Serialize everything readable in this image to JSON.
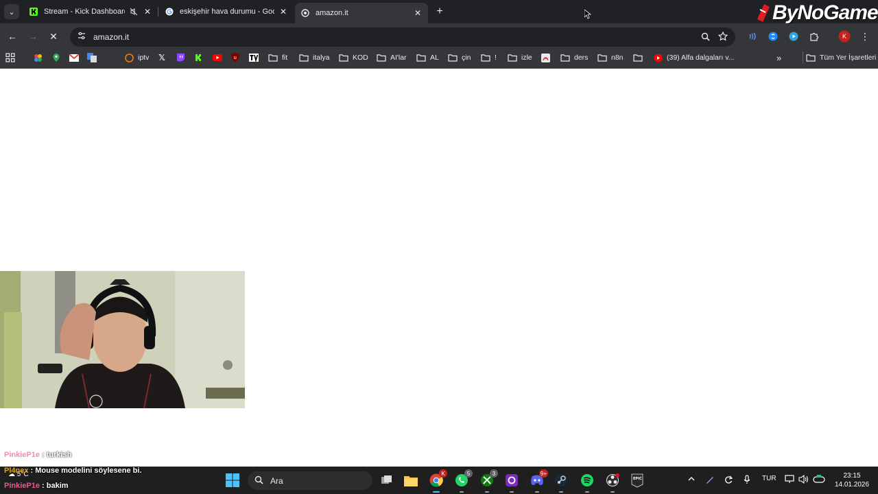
{
  "browser": {
    "tabs": [
      {
        "title": "Stream - Kick Dashboard",
        "muted": true
      },
      {
        "title": "eskişehir hava durumu - Google"
      },
      {
        "title": "amazon.it",
        "active": true
      }
    ],
    "address": "amazon.it",
    "bookmarks": [
      {
        "label": "",
        "icon": "google-photos-icon"
      },
      {
        "label": "",
        "icon": "google-maps-icon"
      },
      {
        "label": "",
        "icon": "gmail-icon"
      },
      {
        "label": "",
        "icon": "google-translate-icon"
      },
      {
        "label": "iptv",
        "icon": "iptv-icon"
      },
      {
        "label": "",
        "icon": "x-icon"
      },
      {
        "label": "",
        "icon": "twitch-icon"
      },
      {
        "label": "",
        "icon": "kick-icon"
      },
      {
        "label": "",
        "icon": "youtube-icon"
      },
      {
        "label": "",
        "icon": "ublock-icon"
      },
      {
        "label": "",
        "icon": "tradingview-icon"
      },
      {
        "label": "fit",
        "icon": "folder-icon"
      },
      {
        "label": "italya",
        "icon": "folder-icon"
      },
      {
        "label": "KOD",
        "icon": "folder-icon"
      },
      {
        "label": "AI'lar",
        "icon": "folder-icon"
      },
      {
        "label": "AL",
        "icon": "folder-icon"
      },
      {
        "label": "çin",
        "icon": "folder-icon"
      },
      {
        "label": "!",
        "icon": "folder-icon"
      },
      {
        "label": "izle",
        "icon": "folder-icon"
      },
      {
        "label": "",
        "icon": "pdf-icon"
      },
      {
        "label": "ders",
        "icon": "folder-icon"
      },
      {
        "label": "n8n",
        "icon": "folder-icon"
      },
      {
        "label": "",
        "icon": "folder-icon"
      },
      {
        "label": "(39) Alfa dalgaları v...",
        "icon": "youtube-icon"
      }
    ],
    "all_bookmarks": "Tüm Yer İşaretleri",
    "profile_initial": "K"
  },
  "overlay": {
    "brand": "ByNoGame",
    "chat": [
      {
        "user": "PinkieP1e",
        "message": " : turkish"
      },
      {
        "user": "Pl4nex",
        "message": " : Mouse modelini söylesene bi."
      },
      {
        "user": "PinkieP1e",
        "message": " : bakim"
      }
    ]
  },
  "taskbar": {
    "weather": "5°C",
    "search_placeholder": "Ara",
    "apps": [
      {
        "name": "task-view-icon"
      },
      {
        "name": "file-explorer-icon"
      },
      {
        "name": "chrome-icon",
        "badge": "K"
      },
      {
        "name": "whatsapp-icon",
        "badge": "5"
      },
      {
        "name": "xbox-icon",
        "badge": "3"
      },
      {
        "name": "app-icon"
      },
      {
        "name": "discord-icon",
        "badge": "9+"
      },
      {
        "name": "steam-icon"
      },
      {
        "name": "spotify-icon"
      },
      {
        "name": "obs-icon"
      },
      {
        "name": "epic-games-icon"
      }
    ],
    "language": "TUR",
    "time": "23:15",
    "date": "14.01.2026"
  },
  "colors": {
    "chrome_dark": "#202124",
    "chrome_toolbar": "#35363a",
    "kick_green": "#53fc18",
    "chat_user": "#e85c8a"
  }
}
